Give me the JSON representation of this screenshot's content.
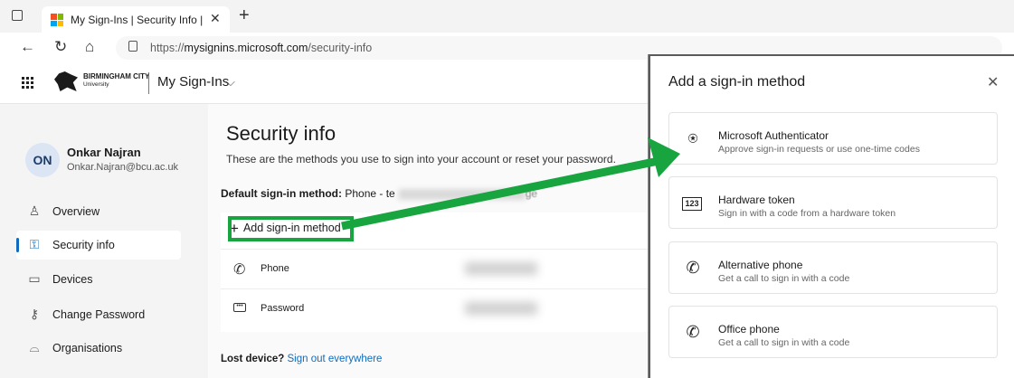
{
  "browser": {
    "tab_title": "My Sign-Ins | Security Info | Micro",
    "tab_close": "✕",
    "new_tab": "+",
    "url_prefix": "https://",
    "url_host": "mysignins.microsoft.com",
    "url_path": "/security-info"
  },
  "header": {
    "org_name": "BIRMINGHAM CITY",
    "org_sub": "University",
    "app_title": "My Sign-Ins",
    "chevron": "⌵"
  },
  "user": {
    "initials": "ON",
    "name": "Onkar Najran",
    "email": "Onkar.Najran@bcu.ac.uk"
  },
  "sidebar": {
    "items": [
      {
        "label": "Overview",
        "icon": "person-icon"
      },
      {
        "label": "Security info",
        "icon": "security-key-icon"
      },
      {
        "label": "Devices",
        "icon": "laptop-icon"
      },
      {
        "label": "Change Password",
        "icon": "key-icon"
      },
      {
        "label": "Organisations",
        "icon": "briefcase-icon"
      }
    ]
  },
  "main": {
    "title": "Security info",
    "subtitle": "These are the methods you use to sign into your account or reset your password.",
    "default_label": "Default sign-in method:",
    "default_value": "Phone - te",
    "default_tail": "ge",
    "add_method": "Add sign-in method",
    "methods": [
      {
        "label": "Phone",
        "icon": "phone-icon"
      },
      {
        "label": "Password",
        "icon": "password-icon"
      }
    ],
    "lost_device": "Lost device?",
    "sign_out_link": "Sign out everywhere"
  },
  "panel": {
    "title": "Add a sign-in method",
    "close": "✕",
    "options": [
      {
        "title": "Microsoft Authenticator",
        "desc": "Approve sign-in requests or use one-time codes",
        "icon": "authenticator-icon"
      },
      {
        "title": "Hardware token",
        "desc": "Sign in with a code from a hardware token",
        "icon": "hardware-token-icon",
        "icon_text": "123"
      },
      {
        "title": "Alternative phone",
        "desc": "Get a call to sign in with a code",
        "icon": "phone-icon"
      },
      {
        "title": "Office phone",
        "desc": "Get a call to sign in with a code",
        "icon": "phone-icon"
      }
    ]
  },
  "colors": {
    "accent": "#0f6cbd",
    "highlight_green": "#18a540"
  }
}
